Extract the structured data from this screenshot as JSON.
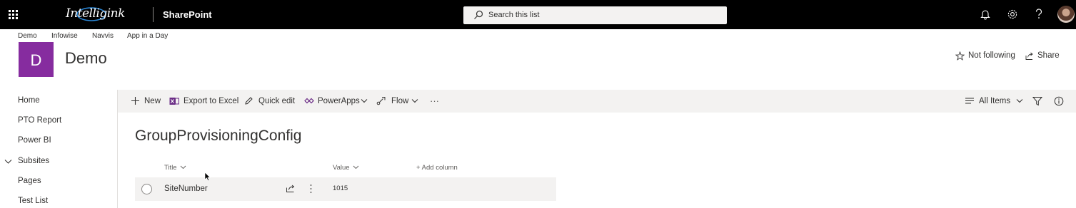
{
  "suite_bar": {
    "brand_logo_text": "Intelligink",
    "app_name": "SharePoint",
    "search_placeholder": "Search this list"
  },
  "hub_nav": [
    "Demo",
    "Infowise",
    "Navvis",
    "App in a Day"
  ],
  "site": {
    "logo_letter": "D",
    "logo_color": "#862c9f",
    "title": "Demo",
    "follow_label": "Not following",
    "share_label": "Share"
  },
  "left_nav": [
    {
      "label": "Home"
    },
    {
      "label": "PTO Report"
    },
    {
      "label": "Power BI"
    },
    {
      "label": "Subsites",
      "expandable": true
    },
    {
      "label": "Pages"
    },
    {
      "label": "Test List"
    }
  ],
  "command_bar": {
    "new": "New",
    "export": "Export to Excel",
    "quick_edit": "Quick edit",
    "powerapps": "PowerApps",
    "flow": "Flow",
    "more": "···",
    "view": "All Items"
  },
  "list": {
    "title": "GroupProvisioningConfig",
    "columns": [
      "Title",
      "Value"
    ],
    "add_column": "+ Add column",
    "rows": [
      {
        "title": "SiteNumber",
        "value": "1015"
      }
    ]
  }
}
